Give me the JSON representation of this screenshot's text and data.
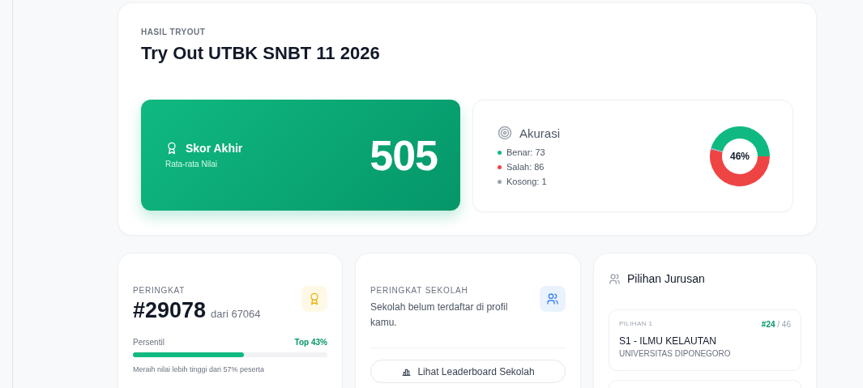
{
  "result": {
    "eyebrow": "HASIL TRYOUT",
    "title": "Try Out UTBK SNBT 11 2026"
  },
  "score": {
    "title": "Skor Akhir",
    "subtitle": "Rata-rata Nilai",
    "value": "505"
  },
  "accuracy": {
    "title": "Akurasi",
    "legend": [
      {
        "label": "Benar: 73",
        "color": "#10b981"
      },
      {
        "label": "Salah: 86",
        "color": "#ef4444"
      },
      {
        "label": "Kosong: 1",
        "color": "#9ca3af"
      }
    ],
    "center_label": "46%",
    "chart_data": {
      "type": "donut",
      "values": [
        45.6,
        53.8,
        0.6
      ]
    }
  },
  "ranking": {
    "label": "PERINGKAT",
    "rank": "#29078",
    "total": "dari 67064",
    "percentile_label": "Persentil",
    "percentile_value": "Top 43%",
    "level": 0.57,
    "caption": "Meraih nilai lebih tinggi dari 57% peserta"
  },
  "school": {
    "label": "PERINGKAT SEKOLAH",
    "message": "Sekolah belum terdaftar di profil kamu.",
    "button": "Lihat Leaderboard Sekolah"
  },
  "majors": {
    "title": "Pilihan Jurusan",
    "items": [
      {
        "kind": "full",
        "choice": "PILIHAN 1",
        "rank": "#24",
        "total": "/ 46",
        "program": "S1 - ILMU KELAUTAN",
        "university": "UNIVERSITAS DIPONEGORO"
      },
      {
        "kind": "cut"
      }
    ]
  }
}
